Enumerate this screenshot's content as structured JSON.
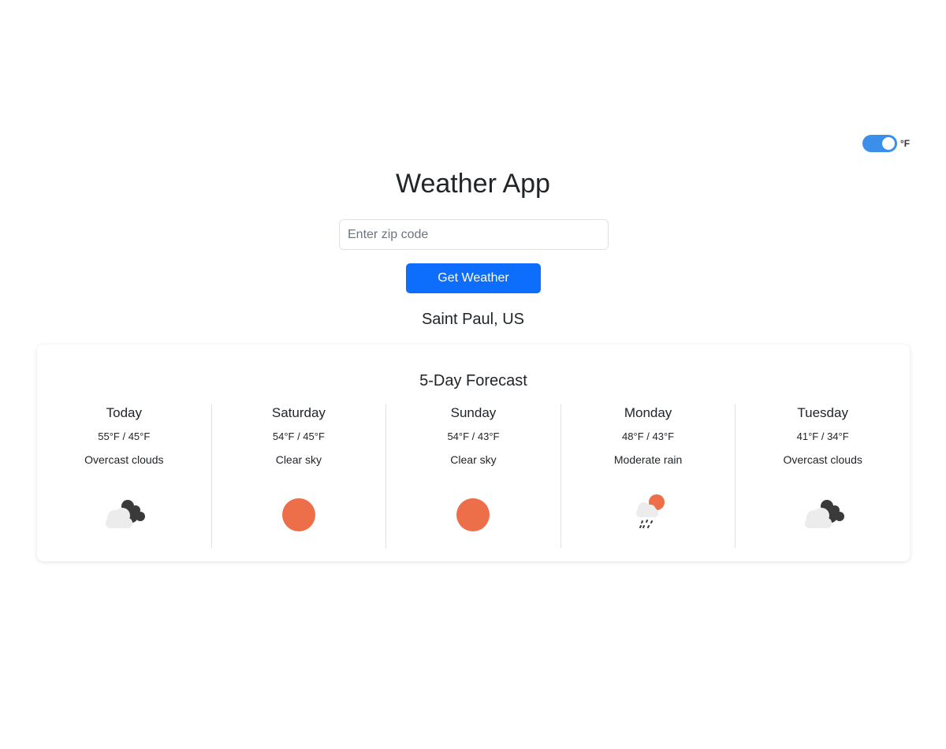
{
  "unit_toggle": {
    "label": "°F"
  },
  "title": "Weather App",
  "search": {
    "placeholder": "Enter zip code",
    "value": ""
  },
  "button": {
    "label": "Get Weather"
  },
  "location": "Saint Paul, US",
  "forecast": {
    "title": "5-Day Forecast",
    "days": [
      {
        "name": "Today",
        "temp": "55°F / 45°F",
        "desc": "Overcast clouds",
        "icon": "overcast-clouds"
      },
      {
        "name": "Saturday",
        "temp": "54°F / 45°F",
        "desc": "Clear sky",
        "icon": "clear-sky"
      },
      {
        "name": "Sunday",
        "temp": "54°F / 43°F",
        "desc": "Clear sky",
        "icon": "clear-sky"
      },
      {
        "name": "Monday",
        "temp": "48°F / 43°F",
        "desc": "Moderate rain",
        "icon": "moderate-rain"
      },
      {
        "name": "Tuesday",
        "temp": "41°F / 34°F",
        "desc": "Overcast clouds",
        "icon": "overcast-clouds"
      }
    ]
  },
  "colors": {
    "accent": "#0d6efd",
    "toggle": "#3b8eea",
    "sun": "#ec6f4a",
    "cloud_light": "#ececec",
    "cloud_dark": "#3a3a3a"
  }
}
